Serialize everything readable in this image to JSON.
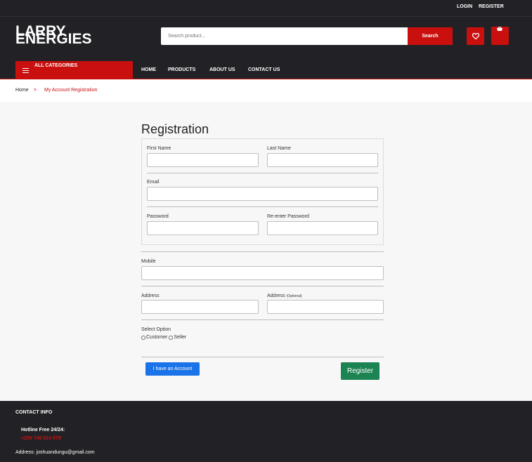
{
  "topbar": {
    "login": "LOGIN",
    "register": "REGISTER"
  },
  "header": {
    "logo_line1": "LARRY",
    "logo_line2": "ENERGIES",
    "search_placeholder": "Search product...",
    "search_button": "Search"
  },
  "nav": {
    "categories": "ALL CATEGORIES",
    "links": [
      "HOME",
      "PRODUCTS",
      "ABOUT US",
      "CONTACT US"
    ]
  },
  "breadcrumb": {
    "home": "Home",
    "separator": ">",
    "current": "My Account Registration"
  },
  "form": {
    "title": "Registration",
    "first_name": "First Name",
    "last_name": "Last Name",
    "email": "Email",
    "password": "Password",
    "reenter_password": "Re-enter Password",
    "mobile": "Mobile",
    "address": "Address",
    "address2": "Address",
    "address2_note": "(Optional)",
    "select_option": "Select Option",
    "option_customer": "Customer",
    "option_seller": "Seller",
    "have_account": "I have an Account",
    "register_button": "Register"
  },
  "footer": {
    "heading": "CONTACT INFO",
    "hotline": "Hotline Free 24/24:",
    "phone": "+256 745 814 979",
    "address": "Address: joshuandungu@gmail.com"
  },
  "colors": {
    "brand_red": "#c9100f",
    "dark": "#222226",
    "register_green": "#1c8352",
    "account_blue": "#1a73e8"
  }
}
